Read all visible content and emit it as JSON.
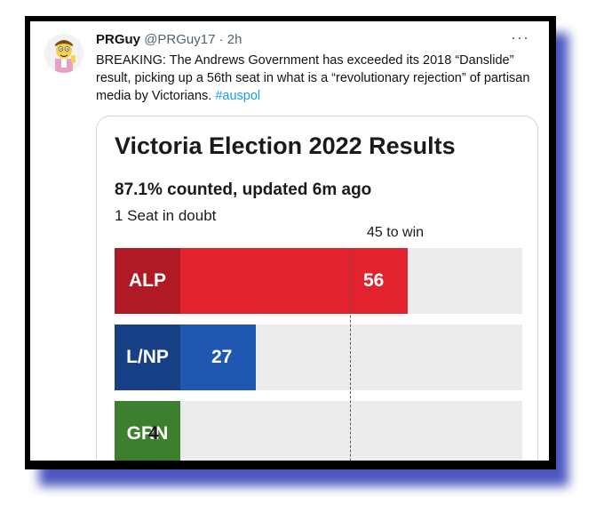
{
  "tweet": {
    "display_name": "PRGuy",
    "handle": "@PRGuy17",
    "separator": "·",
    "time": "2h",
    "more_label": "···",
    "text": "BREAKING: The Andrews Government has exceeded its 2018 “Danslide” result, picking up a 56th seat in what is a “revolutionary rejection” of partisan media by Victorians.",
    "hashtag": "#auspol"
  },
  "card": {
    "title": "Victoria Election 2022 Results",
    "subtitle": "87.1% counted, updated 6m ago",
    "doubt": "1 Seat in doubt",
    "win_label": "45 to win"
  },
  "colors": {
    "alp": "#e2222f",
    "lnp": "#1f57b1",
    "grn": "#4ea53f",
    "track": "#ececec"
  },
  "chart_data": {
    "type": "bar",
    "orientation": "horizontal",
    "title": "Victoria Election 2022 Results",
    "subtitle": "87.1% counted, updated 6m ago",
    "categories": [
      "ALP",
      "L/NP",
      "GRN"
    ],
    "values": [
      56,
      27,
      4
    ],
    "threshold": {
      "value": 45,
      "label": "45 to win"
    },
    "xlim": [
      0,
      78
    ]
  }
}
